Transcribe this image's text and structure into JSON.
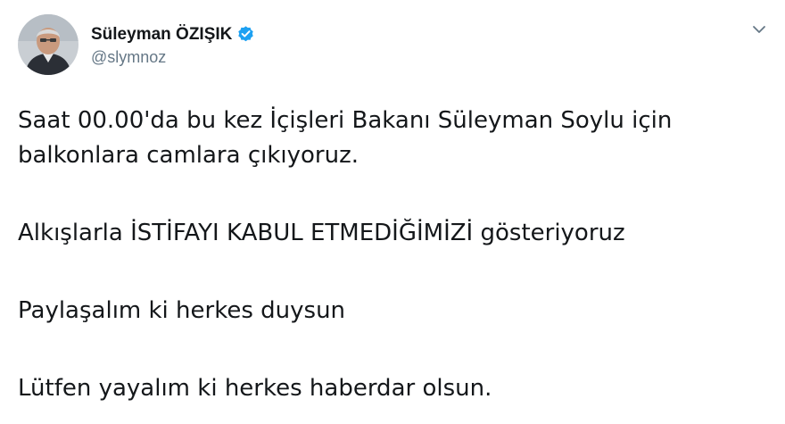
{
  "user": {
    "display_name": "Süleyman ÖZIŞIK",
    "handle": "@slymnoz",
    "verified": true
  },
  "icons": {
    "avatar": "avatar-photo",
    "verified": "verified-badge-icon",
    "menu": "chevron-down-icon"
  },
  "colors": {
    "text": "#14171a",
    "secondary_text": "#657786",
    "verified_blue": "#1da1f2"
  },
  "tweet": {
    "paragraphs": [
      "Saat 00.00'da bu kez İçişleri Bakanı Süleyman Soylu için balkonlara camlara çıkıyoruz.",
      "Alkışlarla İSTİFAYI KABUL ETMEDİĞİMİZİ gösteriyoruz",
      "Paylaşalım ki herkes duysun",
      "Lütfen yayalım ki herkes haberdar olsun."
    ]
  }
}
